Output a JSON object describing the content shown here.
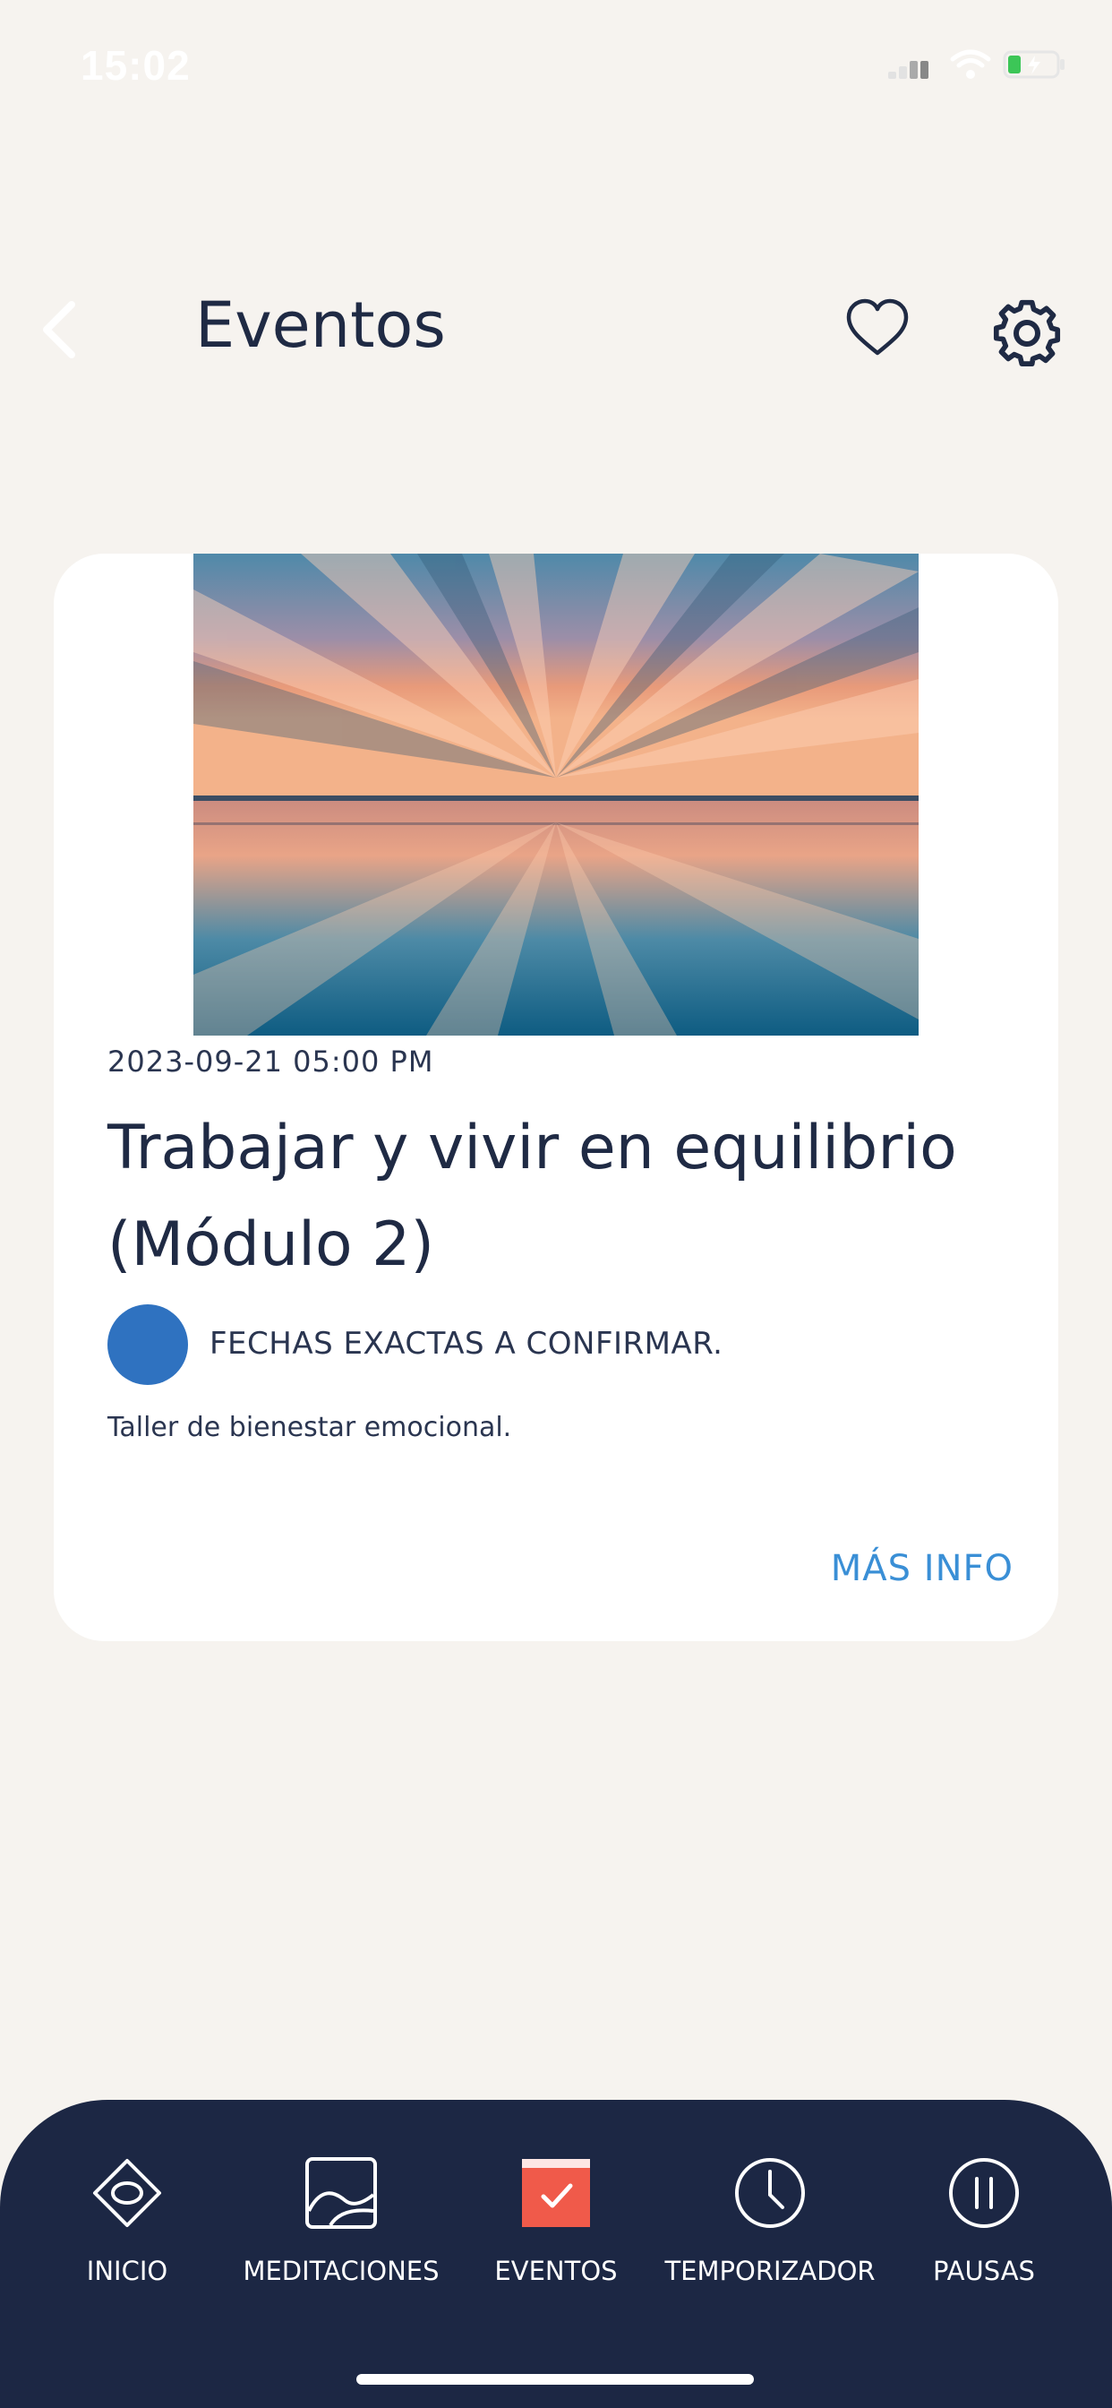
{
  "status_bar": {
    "time": "15:02",
    "icons": [
      "cellular-signal-icon",
      "wifi-icon",
      "battery-icon"
    ]
  },
  "header": {
    "title": "Eventos",
    "back_icon": "chevron-left-icon",
    "favorite_icon": "heart-icon",
    "settings_icon": "gear-icon"
  },
  "event": {
    "image": "sunset-over-sea-photo",
    "datetime": "2023-09-21  05:00 PM",
    "title": "Trabajar y vivir en equilibrio (Módulo 2)",
    "status": "FECHAS EXACTAS A CONFIRMAR.",
    "description": "Taller de bienestar emocional.",
    "more_info": "MÁS INFO"
  },
  "bottom_nav": {
    "items": [
      {
        "label": "INICIO",
        "icon": "eye-diamond-icon",
        "active": false
      },
      {
        "label": "MEDITACIONES",
        "icon": "image-icon",
        "active": false
      },
      {
        "label": "EVENTOS",
        "icon": "calendar-check-icon",
        "active": true
      },
      {
        "label": "TEMPORIZADOR",
        "icon": "clock-icon",
        "active": false
      },
      {
        "label": "PAUSAS",
        "icon": "pause-icon",
        "active": false
      }
    ]
  },
  "colors": {
    "background": "#f6f3ef",
    "navy": "#1c2744",
    "accent_blue": "#3a8fd6",
    "dot_blue": "#2f72c0",
    "active_red": "#f05a4a"
  }
}
